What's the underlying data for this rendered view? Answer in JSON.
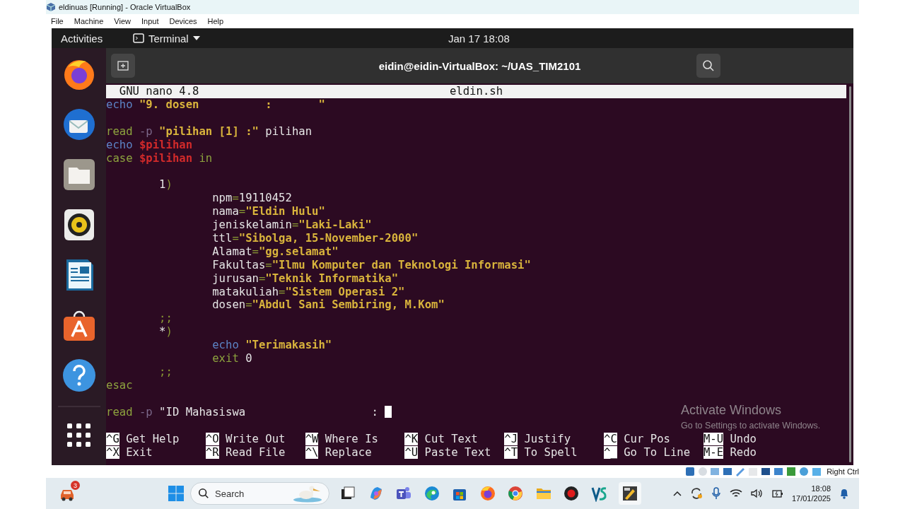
{
  "host_window": {
    "title": "eldinuas [Running] - Oracle VirtualBox",
    "menu": [
      "File",
      "Machine",
      "View",
      "Input",
      "Devices",
      "Help"
    ]
  },
  "top_bar": {
    "activities": "Activities",
    "app_menu": "Terminal",
    "clock": "Jan 17  18:08"
  },
  "terminal": {
    "title": "eidin@eidin-VirtualBox: ~/UAS_TIM2101"
  },
  "nano": {
    "version": "GNU nano 4.8",
    "filename": "eldin.sh",
    "lines": [
      {
        "kind": "code",
        "segments": [
          {
            "text": "echo",
            "kind": "builtin"
          },
          {
            "text": " \"9. dosen          :       \"",
            "kind": "string"
          }
        ]
      },
      {
        "kind": "blank"
      },
      {
        "kind": "code",
        "segments": [
          {
            "text": "read",
            "kind": "keyword"
          },
          {
            "text": " -p",
            "kind": "flag"
          },
          {
            "text": " \"pilihan [1] :\"",
            "kind": "string"
          },
          {
            "text": " pilihan",
            "kind": "plain"
          }
        ]
      },
      {
        "kind": "code",
        "segments": [
          {
            "text": "echo",
            "kind": "builtin"
          },
          {
            "text": " $pilihan",
            "kind": "variable"
          }
        ]
      },
      {
        "kind": "code",
        "segments": [
          {
            "text": "case",
            "kind": "keyword"
          },
          {
            "text": " $pilihan",
            "kind": "variable"
          },
          {
            "text": " in",
            "kind": "keyword"
          }
        ]
      },
      {
        "kind": "blank"
      },
      {
        "kind": "code",
        "segments": [
          {
            "text": "        1",
            "kind": "plain"
          },
          {
            "text": ")",
            "kind": "operator"
          }
        ]
      },
      {
        "kind": "code",
        "segments": [
          {
            "text": "                npm",
            "kind": "plain"
          },
          {
            "text": "=",
            "kind": "operator"
          },
          {
            "text": "19110452",
            "kind": "plain"
          }
        ]
      },
      {
        "kind": "code",
        "segments": [
          {
            "text": "                nama",
            "kind": "plain"
          },
          {
            "text": "=",
            "kind": "operator"
          },
          {
            "text": "\"Eldin Hulu\"",
            "kind": "string"
          }
        ]
      },
      {
        "kind": "code",
        "segments": [
          {
            "text": "                jeniskelamin",
            "kind": "plain"
          },
          {
            "text": "=",
            "kind": "operator"
          },
          {
            "text": "\"Laki-Laki\"",
            "kind": "string"
          }
        ]
      },
      {
        "kind": "code",
        "segments": [
          {
            "text": "                ttl",
            "kind": "plain"
          },
          {
            "text": "=",
            "kind": "operator"
          },
          {
            "text": "\"Sibolga, 15-November-2000\"",
            "kind": "string"
          }
        ]
      },
      {
        "kind": "code",
        "segments": [
          {
            "text": "                Alamat",
            "kind": "plain"
          },
          {
            "text": "=",
            "kind": "operator"
          },
          {
            "text": "\"gg.selamat\"",
            "kind": "string"
          }
        ]
      },
      {
        "kind": "code",
        "segments": [
          {
            "text": "                Fakultas",
            "kind": "plain"
          },
          {
            "text": "=",
            "kind": "operator"
          },
          {
            "text": "\"Ilmu Komputer dan Teknologi Informasi\"",
            "kind": "string"
          }
        ]
      },
      {
        "kind": "code",
        "segments": [
          {
            "text": "                jurusan",
            "kind": "plain"
          },
          {
            "text": "=",
            "kind": "operator"
          },
          {
            "text": "\"Teknik Informatika\"",
            "kind": "string"
          }
        ]
      },
      {
        "kind": "code",
        "segments": [
          {
            "text": "                matakuliah",
            "kind": "plain"
          },
          {
            "text": "=",
            "kind": "operator"
          },
          {
            "text": "\"Sistem Operasi 2\"",
            "kind": "string"
          }
        ]
      },
      {
        "kind": "code",
        "segments": [
          {
            "text": "                dosen",
            "kind": "plain"
          },
          {
            "text": "=",
            "kind": "operator"
          },
          {
            "text": "\"Abdul Sani Sembiring, M.Kom\"",
            "kind": "string"
          }
        ]
      },
      {
        "kind": "code",
        "segments": [
          {
            "text": "        ;;",
            "kind": "operator"
          }
        ]
      },
      {
        "kind": "code",
        "segments": [
          {
            "text": "        *",
            "kind": "plain"
          },
          {
            "text": ")",
            "kind": "operator"
          }
        ]
      },
      {
        "kind": "code",
        "segments": [
          {
            "text": "                echo",
            "kind": "builtin"
          },
          {
            "text": " \"Terimakasih\"",
            "kind": "string"
          }
        ]
      },
      {
        "kind": "code",
        "segments": [
          {
            "text": "                exit",
            "kind": "keyword"
          },
          {
            "text": " 0",
            "kind": "plain"
          }
        ]
      },
      {
        "kind": "code",
        "segments": [
          {
            "text": "        ;;",
            "kind": "operator"
          }
        ]
      },
      {
        "kind": "code",
        "segments": [
          {
            "text": "esac",
            "kind": "keyword"
          }
        ]
      },
      {
        "kind": "blank"
      },
      {
        "kind": "code",
        "segments": [
          {
            "text": "read",
            "kind": "keyword"
          },
          {
            "text": " -p",
            "kind": "flag"
          },
          {
            "text": " \"ID Mahasiswa                   :",
            "kind": "plain"
          }
        ]
      }
    ],
    "shortcuts": [
      {
        "key": "^G",
        "label": "Get Help"
      },
      {
        "key": "^O",
        "label": "Write Out"
      },
      {
        "key": "^W",
        "label": "Where Is"
      },
      {
        "key": "^K",
        "label": "Cut Text"
      },
      {
        "key": "^J",
        "label": "Justify"
      },
      {
        "key": "^C",
        "label": "Cur Pos"
      },
      {
        "key": "M-U",
        "label": "Undo"
      },
      {
        "key": "^X",
        "label": "Exit"
      },
      {
        "key": "^R",
        "label": "Read File"
      },
      {
        "key": "^\\",
        "label": "Replace"
      },
      {
        "key": "^U",
        "label": "Paste Text"
      },
      {
        "key": "^T",
        "label": "To Spell"
      },
      {
        "key": "^_",
        "label": "Go To Line"
      },
      {
        "key": "M-E",
        "label": "Redo"
      }
    ]
  },
  "activation_notice": {
    "title": "Activate Windows",
    "text": "Go to Settings to activate Windows."
  },
  "vm_status_bar": {
    "host_key": "Right Ctrl"
  },
  "taskbar": {
    "notification_count": "3",
    "search_placeholder": "Search",
    "time": "18:08",
    "date": "17/01/2025"
  }
}
